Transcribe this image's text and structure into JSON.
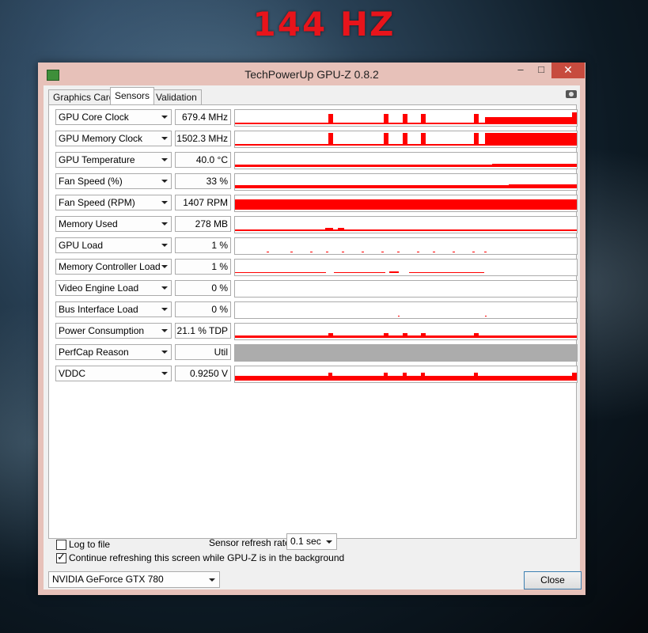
{
  "banner": {
    "text": "144 HZ"
  },
  "window": {
    "title": "TechPowerUp GPU-Z 0.8.2",
    "min_glyph": "–",
    "max_glyph": "□",
    "close_glyph": "✕"
  },
  "tabs": [
    {
      "label": "Graphics Card",
      "active": false
    },
    {
      "label": "Sensors",
      "active": true
    },
    {
      "label": "Validation",
      "active": false
    }
  ],
  "sensors": [
    {
      "name": "GPU Core Clock",
      "value": "679.4 MHz"
    },
    {
      "name": "GPU Memory Clock",
      "value": "1502.3 MHz"
    },
    {
      "name": "GPU Temperature",
      "value": "40.0 °C"
    },
    {
      "name": "Fan Speed (%)",
      "value": "33 %"
    },
    {
      "name": "Fan Speed (RPM)",
      "value": "1407 RPM"
    },
    {
      "name": "Memory Used",
      "value": "278 MB"
    },
    {
      "name": "GPU Load",
      "value": "1 %"
    },
    {
      "name": "Memory Controller Load",
      "value": "1 %"
    },
    {
      "name": "Video Engine Load",
      "value": "0 %"
    },
    {
      "name": "Bus Interface Load",
      "value": "0 %"
    },
    {
      "name": "Power Consumption",
      "value": "21.1 % TDP"
    },
    {
      "name": "PerfCap Reason",
      "value": "Util"
    },
    {
      "name": "VDDC",
      "value": "0.9250 V"
    }
  ],
  "graph_color": "#ff0000",
  "footer": {
    "log_to_file": {
      "label": "Log to file",
      "checked": false
    },
    "refresh_rate_label": "Sensor refresh rate:",
    "refresh_rate_value": "0.1 sec",
    "continue_refresh": {
      "label": "Continue refreshing this screen while GPU-Z is in the background",
      "checked": true
    },
    "gpu_select": "NVIDIA GeForce GTX 780",
    "close_label": "Close"
  }
}
